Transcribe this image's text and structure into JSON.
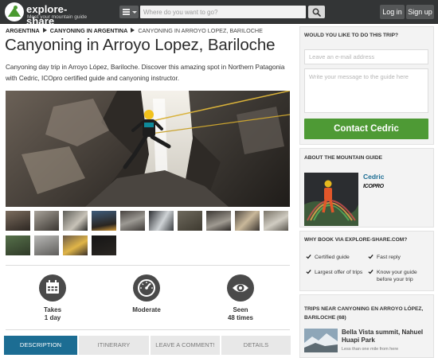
{
  "topbar": {
    "logo_name": "explore-share",
    "logo_tagline": "Meet your mountain guide",
    "search_placeholder": "Where do you want to go?",
    "login_label": "Log in",
    "signup_label": "Sign up"
  },
  "breadcrumb": {
    "items": [
      "ARGENTINA",
      "CANYONING IN ARGENTINA",
      "CANYONING IN ARROYO LOPEZ, BARILOCHE"
    ]
  },
  "trip": {
    "title": "Canyoning in Arroyo Lopez, Bariloche",
    "intro": "Canyoning day trip in Arroyo López, Bariloche. Discover this amazing spot in Northern Patagonia with Cedric, ICOpro certified guide and canyoning instructor."
  },
  "stats": [
    {
      "icon": "calendar-icon",
      "line1": "Takes",
      "line2": "1 day"
    },
    {
      "icon": "gauge-icon",
      "line1": "Moderate",
      "line2": ""
    },
    {
      "icon": "eye-icon",
      "line1": "Seen",
      "line2": "48 times"
    }
  ],
  "tabs": [
    {
      "label": "DESCRIPTION",
      "active": true
    },
    {
      "label": "ITINERARY",
      "active": false
    },
    {
      "label": "LEAVE A COMMENT!",
      "active": false
    },
    {
      "label": "DETAILS",
      "active": false
    }
  ],
  "sidebar": {
    "contact": {
      "heading": "WOULD YOU LIKE TO DO THIS TRIP?",
      "email_placeholder": "Leave an e-mail address",
      "message_placeholder": "Write your message to the guide here",
      "button_label": "Contact Cedric"
    },
    "guide": {
      "heading": "ABOUT THE MOUNTAIN GUIDE",
      "name": "Cedric",
      "badge": "ICOPRO"
    },
    "why": {
      "heading": "WHY BOOK VIA EXPLORE-SHARE.COM?",
      "items": [
        "Certified guide",
        "Fast reply",
        "Largest offer of trips",
        "Know your guide before your trip"
      ]
    },
    "nearby": {
      "heading": "TRIPS NEAR CANYONING EN ARROYO LÓPEZ, BARILOCHE (68)",
      "trip_name": "Bella Vista summit, Nahuel Huapi Park",
      "trip_distance": "Less than one mile from here"
    }
  },
  "colors": {
    "topbar": "#333536",
    "accent_blue": "#1c6d93",
    "contact_green": "#4e9a35",
    "sidebar_bg": "#f3f3f3"
  }
}
